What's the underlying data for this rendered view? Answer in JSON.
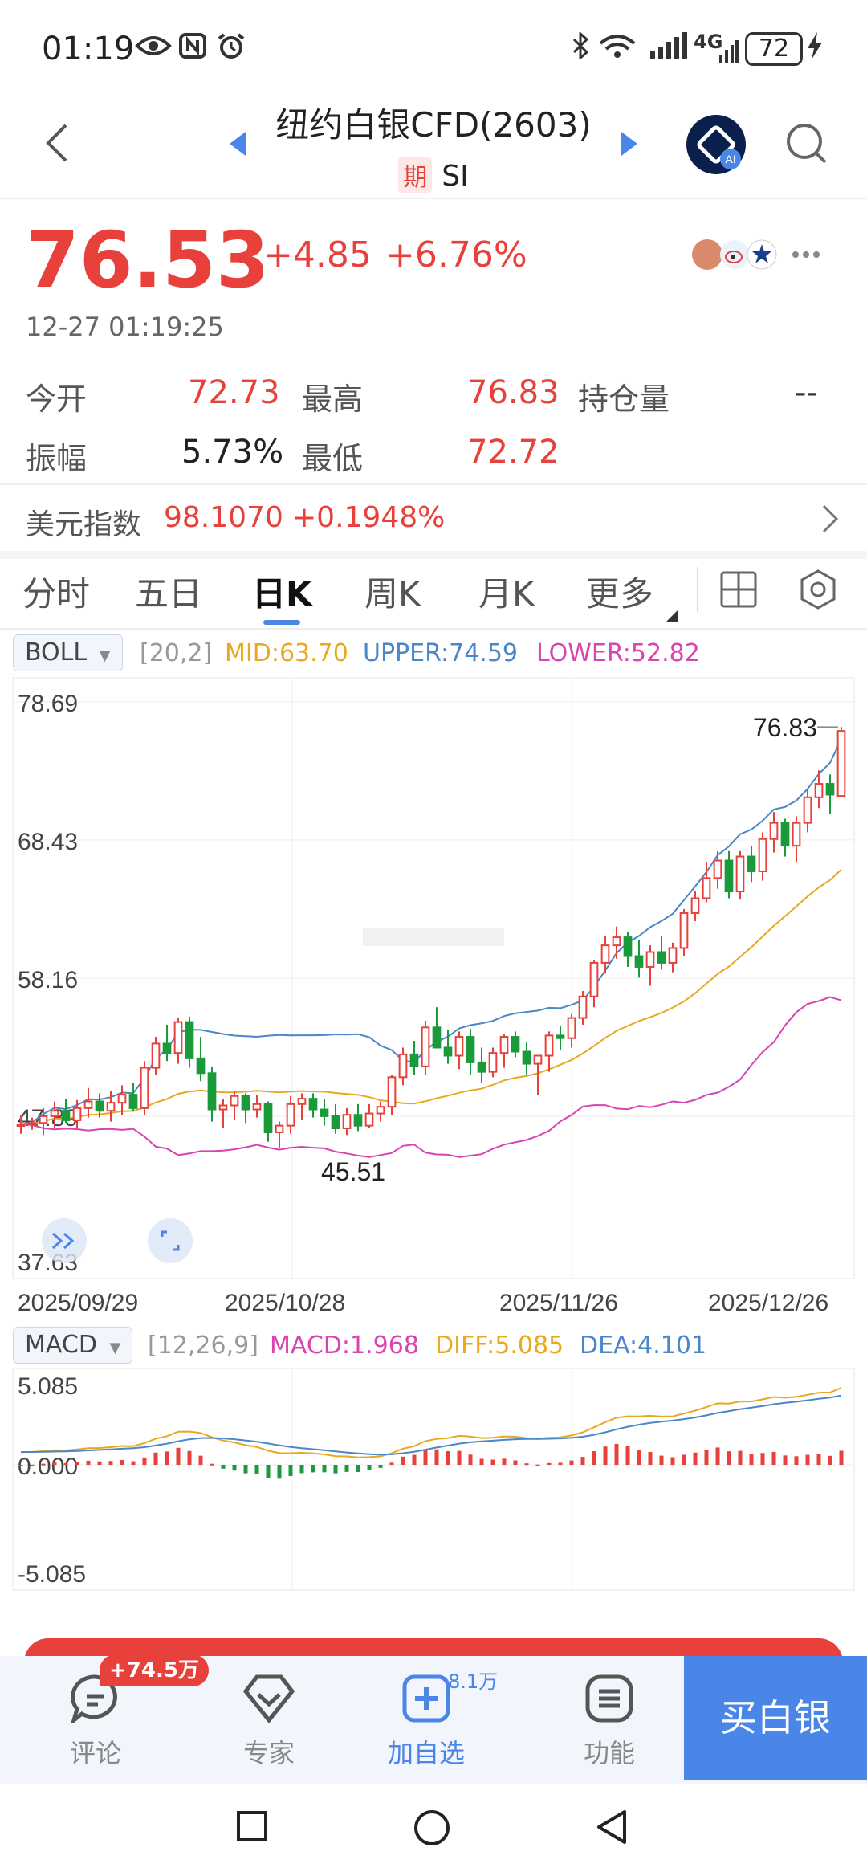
{
  "status_bar": {
    "time": "01:19",
    "battery": "72",
    "network": "4G"
  },
  "header": {
    "title": "纽约白银CFD(2603)",
    "tag": "期",
    "symbol": "SI"
  },
  "quote": {
    "price": "76.53",
    "change": "+4.85",
    "change_pct": "+6.76%",
    "timestamp": "12-27 01:19:25"
  },
  "stats": {
    "open_label": "今开",
    "open": "72.73",
    "high_label": "最高",
    "high": "76.83",
    "oi_label": "持仓量",
    "oi": "--",
    "amp_label": "振幅",
    "amp": "5.73%",
    "low_label": "最低",
    "low": "72.72"
  },
  "dxy": {
    "label": "美元指数",
    "value": "98.1070",
    "change": "+0.1948%"
  },
  "tabs": [
    "分时",
    "五日",
    "日K",
    "周K",
    "月K",
    "更多"
  ],
  "active_tab": 2,
  "boll": {
    "name": "BOLL",
    "params": "[20,2]",
    "mid": "MID:63.70",
    "upper": "UPPER:74.59",
    "lower": "LOWER:52.82"
  },
  "macd": {
    "name": "MACD",
    "params": "[12,26,9]",
    "macd": "MACD:1.968",
    "diff": "DIFF:5.085",
    "dea": "DEA:4.101"
  },
  "colors": {
    "up": "#e8403a",
    "down": "#1a9a3a",
    "mid": "#e8a820",
    "upper": "#4a86c8",
    "lower": "#d844b0",
    "accent": "#4a86e8"
  },
  "chart_data": [
    {
      "type": "candlestick",
      "title": "日K BOLL[20,2]",
      "y_ticks": [
        "78.69",
        "68.43",
        "58.16",
        "47.89",
        "37.63"
      ],
      "x_ticks": [
        "2025/09/29",
        "2025/10/28",
        "2025/11/26",
        "2025/12/26"
      ],
      "ylim": [
        37.63,
        78.69
      ],
      "annotations": {
        "high": "76.83",
        "low": "45.51"
      },
      "candles": [
        [
          47.2,
          48.0,
          46.6,
          47.3
        ],
        [
          47.3,
          47.8,
          46.9,
          47.4
        ],
        [
          47.4,
          48.5,
          46.5,
          47.9
        ],
        [
          47.9,
          49.0,
          47.0,
          48.3
        ],
        [
          48.3,
          49.2,
          47.4,
          47.6
        ],
        [
          47.6,
          49.1,
          47.0,
          48.5
        ],
        [
          48.5,
          50.0,
          47.8,
          49.0
        ],
        [
          49.0,
          49.6,
          47.8,
          48.3
        ],
        [
          48.3,
          49.8,
          47.5,
          48.9
        ],
        [
          48.9,
          50.2,
          48.0,
          49.5
        ],
        [
          49.5,
          50.4,
          48.3,
          48.5
        ],
        [
          48.5,
          52.0,
          48.0,
          51.5
        ],
        [
          51.5,
          53.8,
          51.0,
          53.3
        ],
        [
          53.3,
          54.7,
          52.0,
          52.6
        ],
        [
          52.6,
          55.2,
          51.8,
          54.9
        ],
        [
          54.9,
          55.3,
          51.5,
          52.2
        ],
        [
          52.2,
          53.8,
          50.5,
          51.1
        ],
        [
          51.1,
          51.6,
          47.5,
          48.4
        ],
        [
          48.4,
          49.2,
          47.0,
          48.7
        ],
        [
          48.7,
          49.8,
          47.6,
          49.4
        ],
        [
          49.4,
          49.6,
          47.4,
          48.4
        ],
        [
          48.4,
          49.5,
          47.8,
          48.8
        ],
        [
          48.8,
          49.0,
          46.0,
          46.7
        ],
        [
          46.7,
          47.5,
          45.51,
          47.2
        ],
        [
          47.2,
          49.4,
          46.6,
          48.8
        ],
        [
          48.8,
          49.6,
          47.6,
          49.2
        ],
        [
          49.2,
          49.6,
          47.8,
          48.4
        ],
        [
          48.4,
          49.2,
          47.2,
          47.9
        ],
        [
          47.9,
          48.8,
          46.6,
          47.0
        ],
        [
          47.0,
          48.5,
          46.5,
          48.0
        ],
        [
          48.0,
          48.8,
          46.8,
          47.2
        ],
        [
          47.2,
          48.8,
          47.0,
          48.1
        ],
        [
          48.1,
          49.0,
          47.5,
          48.6
        ],
        [
          48.6,
          51.0,
          48.0,
          50.8
        ],
        [
          50.8,
          53.0,
          50.2,
          52.5
        ],
        [
          52.5,
          53.5,
          51.0,
          51.6
        ],
        [
          51.6,
          55.0,
          51.0,
          54.5
        ],
        [
          54.5,
          56.0,
          53.5,
          53.0
        ],
        [
          53.0,
          54.3,
          51.8,
          52.4
        ],
        [
          52.4,
          54.2,
          51.4,
          53.8
        ],
        [
          53.8,
          54.4,
          51.0,
          51.9
        ],
        [
          51.9,
          53.0,
          50.4,
          51.2
        ],
        [
          51.2,
          53.0,
          50.8,
          52.6
        ],
        [
          52.6,
          54.0,
          51.5,
          53.8
        ],
        [
          53.8,
          54.2,
          52.3,
          52.7
        ],
        [
          52.7,
          53.4,
          51.0,
          51.8
        ],
        [
          51.8,
          52.4,
          49.5,
          52.4
        ],
        [
          52.4,
          54.2,
          51.2,
          53.9
        ],
        [
          53.9,
          54.6,
          52.8,
          53.7
        ],
        [
          53.7,
          55.5,
          53.0,
          55.2
        ],
        [
          55.2,
          57.2,
          54.7,
          56.8
        ],
        [
          56.8,
          59.5,
          56.0,
          59.3
        ],
        [
          59.3,
          61.3,
          58.5,
          60.6
        ],
        [
          60.6,
          62.0,
          59.6,
          61.2
        ],
        [
          61.2,
          61.6,
          59.0,
          59.8
        ],
        [
          59.8,
          61.0,
          58.2,
          59.0
        ],
        [
          59.0,
          60.6,
          57.6,
          60.1
        ],
        [
          60.1,
          61.3,
          58.8,
          59.3
        ],
        [
          59.3,
          60.8,
          58.6,
          60.4
        ],
        [
          60.4,
          63.3,
          59.8,
          63.0
        ],
        [
          63.0,
          64.6,
          62.4,
          64.1
        ],
        [
          64.1,
          66.8,
          63.8,
          65.6
        ],
        [
          65.6,
          67.6,
          64.8,
          66.9
        ],
        [
          66.9,
          67.6,
          64.1,
          64.6
        ],
        [
          64.6,
          67.6,
          64.0,
          67.2
        ],
        [
          67.2,
          68.0,
          65.3,
          66.1
        ],
        [
          66.1,
          69.0,
          65.4,
          68.5
        ],
        [
          68.5,
          70.5,
          67.5,
          69.7
        ],
        [
          69.7,
          70.0,
          67.2,
          68.0
        ],
        [
          68.0,
          70.2,
          66.8,
          69.7
        ],
        [
          69.7,
          72.2,
          69.0,
          71.6
        ],
        [
          71.6,
          73.6,
          70.8,
          72.6
        ],
        [
          72.6,
          73.3,
          70.4,
          71.8
        ],
        [
          71.7,
          76.83,
          71.6,
          76.53
        ]
      ]
    },
    {
      "type": "bar",
      "title": "MACD[12,26,9]",
      "y_ticks": [
        "5.085",
        "0.000",
        "-5.085"
      ],
      "ylim": [
        -5.085,
        5.085
      ]
    }
  ],
  "bottom_nav": {
    "comment": "评论",
    "comment_badge": "+74.5万",
    "expert": "专家",
    "add": "加自选",
    "add_badge": "8.1万",
    "func": "功能",
    "buy": "买白银"
  }
}
